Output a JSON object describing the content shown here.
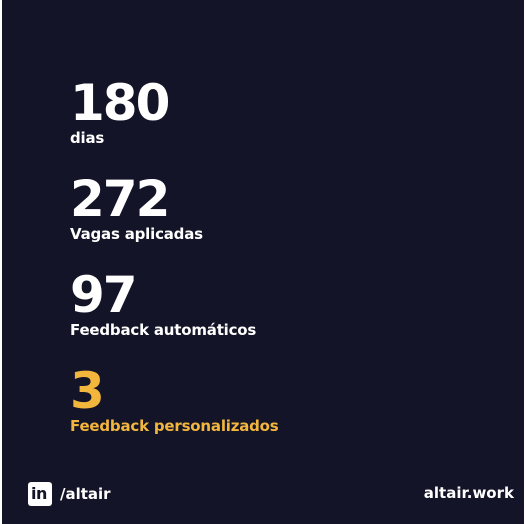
{
  "stats": [
    {
      "number": "180",
      "label": "dias"
    },
    {
      "number": "272",
      "label": "Vagas aplicadas"
    },
    {
      "number": "97",
      "label": "Feedback automáticos"
    },
    {
      "number": "3",
      "label": "Feedback personalizados"
    }
  ],
  "footer": {
    "linkedin_icon": "linkedin-icon",
    "linkedin_icon_text": "in",
    "handle": "/altair",
    "site": "altair.work"
  },
  "colors": {
    "background": "#141428",
    "text": "#ffffff",
    "highlight": "#f2b63d"
  }
}
